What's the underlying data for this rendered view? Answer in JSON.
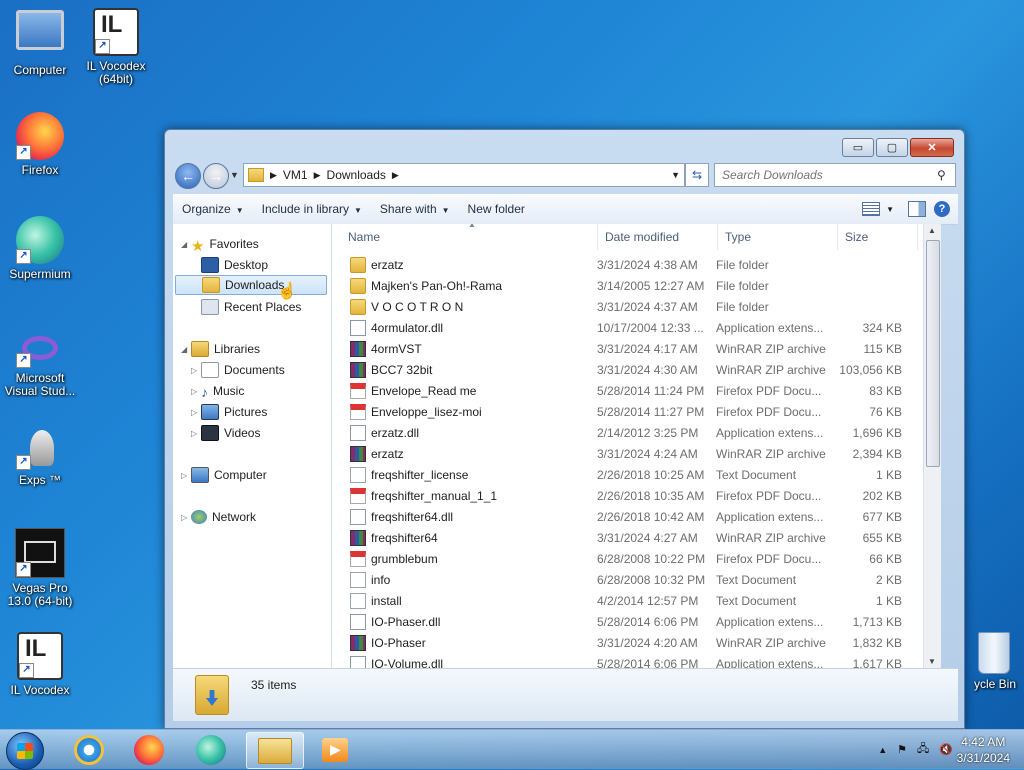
{
  "desktop": {
    "icons": [
      {
        "label": "Computer",
        "icon": "computer-icon"
      },
      {
        "label": "IL Vocodex (64bit)",
        "icon": "il-vocodex-icon"
      },
      {
        "label": "Firefox",
        "icon": "firefox-icon"
      },
      {
        "label": "Supermium",
        "icon": "supermium-icon"
      },
      {
        "label": "Microsoft Visual Stud...",
        "icon": "visual-studio-icon"
      },
      {
        "label": "Exps ™",
        "icon": "exps-icon"
      },
      {
        "label": "Vegas Pro 13.0 (64-bit)",
        "icon": "vegas-pro-icon"
      },
      {
        "label": "IL Vocodex",
        "icon": "il-vocodex-icon"
      },
      {
        "label": "ycle Bin",
        "icon": "recycle-bin-icon"
      }
    ]
  },
  "window": {
    "caption_buttons": {
      "minimize": "▭",
      "maximize": "▢",
      "close": "✕"
    },
    "address": {
      "parts": [
        "VM1",
        "Downloads"
      ]
    },
    "search": {
      "placeholder": "Search Downloads"
    },
    "toolbar": {
      "organize": "Organize",
      "include_in_library": "Include in library",
      "share_with": "Share with",
      "new_folder": "New folder"
    },
    "nav": {
      "favorites": "Favorites",
      "desktop": "Desktop",
      "downloads": "Downloads",
      "recent_places": "Recent Places",
      "libraries": "Libraries",
      "documents": "Documents",
      "music": "Music",
      "pictures": "Pictures",
      "videos": "Videos",
      "computer": "Computer",
      "network": "Network"
    },
    "columns": {
      "name": "Name",
      "date": "Date modified",
      "type": "Type",
      "size": "Size"
    },
    "files": [
      {
        "name": "erzatz",
        "date": "3/31/2024 4:38 AM",
        "type": "File folder",
        "size": "",
        "kind": "folder"
      },
      {
        "name": "Majken's Pan-Oh!-Rama",
        "date": "3/14/2005 12:27 AM",
        "type": "File folder",
        "size": "",
        "kind": "folder"
      },
      {
        "name": "V O C O T R O N",
        "date": "3/31/2024 4:37 AM",
        "type": "File folder",
        "size": "",
        "kind": "folder"
      },
      {
        "name": "4ormulator.dll",
        "date": "10/17/2004 12:33 ...",
        "type": "Application extens...",
        "size": "324 KB",
        "kind": "dll"
      },
      {
        "name": "4ormVST",
        "date": "3/31/2024 4:17 AM",
        "type": "WinRAR ZIP archive",
        "size": "115 KB",
        "kind": "zip"
      },
      {
        "name": "BCC7 32bit",
        "date": "3/31/2024 4:30 AM",
        "type": "WinRAR ZIP archive",
        "size": "103,056 KB",
        "kind": "zip"
      },
      {
        "name": "Envelope_Read me",
        "date": "5/28/2014 11:24 PM",
        "type": "Firefox PDF Docu...",
        "size": "83 KB",
        "kind": "pdf"
      },
      {
        "name": "Enveloppe_lisez-moi",
        "date": "5/28/2014 11:27 PM",
        "type": "Firefox PDF Docu...",
        "size": "76 KB",
        "kind": "pdf"
      },
      {
        "name": "erzatz.dll",
        "date": "2/14/2012 3:25 PM",
        "type": "Application extens...",
        "size": "1,696 KB",
        "kind": "dll"
      },
      {
        "name": "erzatz",
        "date": "3/31/2024 4:24 AM",
        "type": "WinRAR ZIP archive",
        "size": "2,394 KB",
        "kind": "zip"
      },
      {
        "name": "freqshifter_license",
        "date": "2/26/2018 10:25 AM",
        "type": "Text Document",
        "size": "1 KB",
        "kind": "txt"
      },
      {
        "name": "freqshifter_manual_1_1",
        "date": "2/26/2018 10:35 AM",
        "type": "Firefox PDF Docu...",
        "size": "202 KB",
        "kind": "pdf"
      },
      {
        "name": "freqshifter64.dll",
        "date": "2/26/2018 10:42 AM",
        "type": "Application extens...",
        "size": "677 KB",
        "kind": "dll"
      },
      {
        "name": "freqshifter64",
        "date": "3/31/2024 4:27 AM",
        "type": "WinRAR ZIP archive",
        "size": "655 KB",
        "kind": "zip"
      },
      {
        "name": "grumblebum",
        "date": "6/28/2008 10:22 PM",
        "type": "Firefox PDF Docu...",
        "size": "66 KB",
        "kind": "pdf"
      },
      {
        "name": "info",
        "date": "6/28/2008 10:32 PM",
        "type": "Text Document",
        "size": "2 KB",
        "kind": "txt"
      },
      {
        "name": "install",
        "date": "4/2/2014 12:57 PM",
        "type": "Text Document",
        "size": "1 KB",
        "kind": "txt"
      },
      {
        "name": "IO-Phaser.dll",
        "date": "5/28/2014 6:06 PM",
        "type": "Application extens...",
        "size": "1,713 KB",
        "kind": "dll"
      },
      {
        "name": "IO-Phaser",
        "date": "3/31/2024 4:20 AM",
        "type": "WinRAR ZIP archive",
        "size": "1,832 KB",
        "kind": "zip"
      },
      {
        "name": "IO-Volume.dll",
        "date": "5/28/2014 6:06 PM",
        "type": "Application extens...",
        "size": "1,617 KB",
        "kind": "dll"
      }
    ],
    "status": {
      "count": "35 items"
    }
  },
  "taskbar": {
    "clock": {
      "time": "4:42 AM",
      "date": "3/31/2024"
    }
  }
}
